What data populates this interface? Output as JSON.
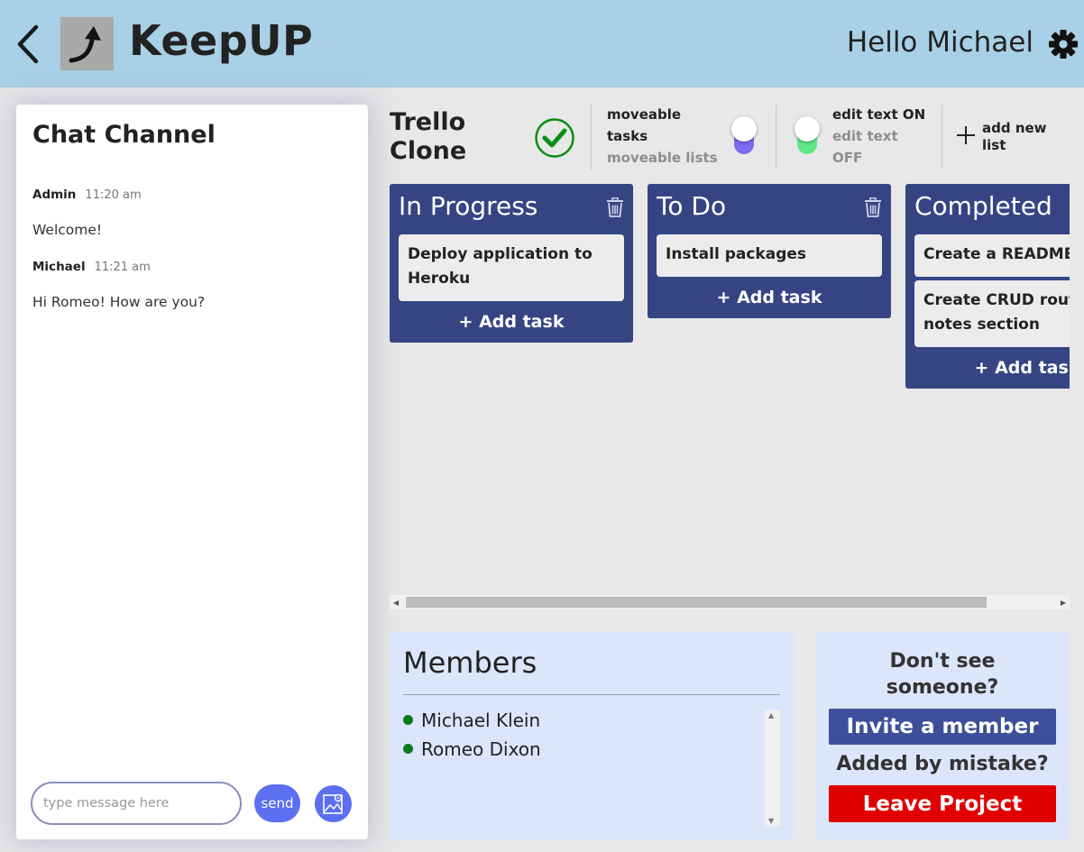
{
  "header": {
    "brand": "KeepUP",
    "greeting": "Hello Michael"
  },
  "chat": {
    "title": "Chat Channel",
    "messages": [
      {
        "user": "Admin",
        "time": "11:20 am",
        "text": "Welcome!"
      },
      {
        "user": "Michael",
        "time": "11:21 am",
        "text": "Hi Romeo! How are you?"
      }
    ],
    "input_placeholder": "type message here",
    "send_label": "send"
  },
  "board": {
    "title_line1": "Trello",
    "title_line2": "Clone",
    "toggles": {
      "move": {
        "active": "moveable tasks",
        "inactive": "moveable lists",
        "color": "#7b6cf0"
      },
      "edit": {
        "active": "edit text ON",
        "inactive": "edit text OFF",
        "color": "#5fe88a"
      }
    },
    "add_list_label": "add new list",
    "lists": [
      {
        "title": "In Progress",
        "cards": [
          "Deploy application to Heroku"
        ],
        "add_label": "+ Add task"
      },
      {
        "title": "To Do",
        "cards": [
          "Install packages"
        ],
        "add_label": "+ Add task"
      },
      {
        "title": "Completed",
        "cards": [
          "Create a README",
          "Create CRUD routes for notes section"
        ],
        "add_label": "+ Add task"
      }
    ]
  },
  "members": {
    "title": "Members",
    "list": [
      "Michael Klein",
      "Romeo Dixon"
    ]
  },
  "invite": {
    "question1": "Don't see someone?",
    "invite_label": "Invite a member",
    "question2": "Added by mistake?",
    "leave_label": "Leave Project"
  },
  "colors": {
    "header_bg": "#a8d0e6",
    "list_bg": "#364484",
    "send_bg": "#5b6ff0",
    "leave_bg": "#e00000",
    "online": "#0b7a1c"
  }
}
